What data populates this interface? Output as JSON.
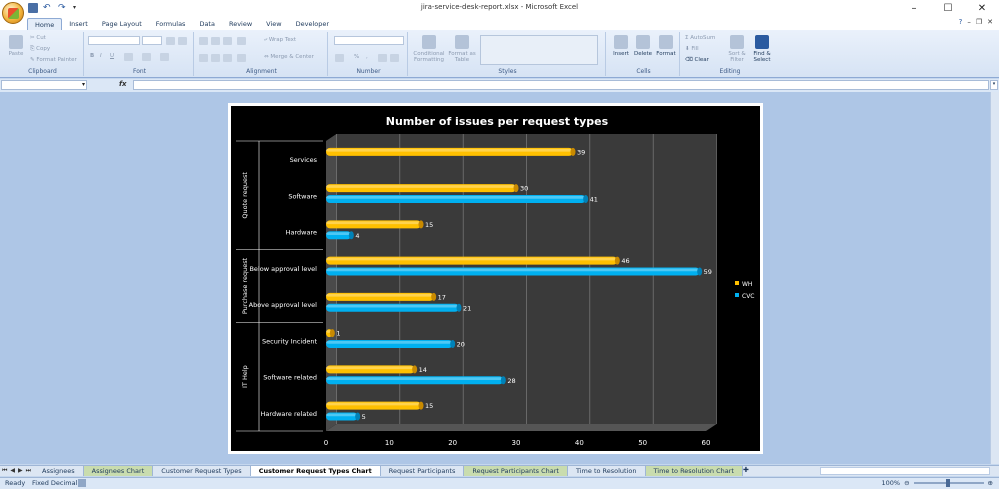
{
  "window": {
    "title": "jira-service-desk-report.xlsx - Microsoft Excel",
    "controls": [
      "–",
      "☐",
      "✕"
    ]
  },
  "ribbon_tabs": [
    "Home",
    "Insert",
    "Page Layout",
    "Formulas",
    "Data",
    "Review",
    "View",
    "Developer"
  ],
  "ribbon": {
    "clipboard": {
      "paste": "Paste",
      "cut": "Cut",
      "copy": "Copy",
      "format_painter": "Format Painter",
      "label": "Clipboard"
    },
    "font": {
      "label": "Font"
    },
    "alignment": {
      "wrap_text": "Wrap Text",
      "merge_center": "Merge & Center",
      "label": "Alignment"
    },
    "number": {
      "label": "Number"
    },
    "styles": {
      "conditional": "Conditional Formatting",
      "format_table": "Format as Table",
      "label": "Styles"
    },
    "cells": {
      "insert": "Insert",
      "delete": "Delete",
      "format": "Format",
      "label": "Cells"
    },
    "editing": {
      "autosum": "AutoSum",
      "fill": "Fill",
      "clear": "Clear",
      "sort_filter": "Sort & Filter",
      "find_select": "Find & Select",
      "label": "Editing"
    }
  },
  "formula_bar": {
    "fx": "fx",
    "name_box": "",
    "content": ""
  },
  "sheet_tabs": [
    {
      "label": "Assignees",
      "chart": false,
      "active": false
    },
    {
      "label": "Assignees Chart",
      "chart": true,
      "active": false
    },
    {
      "label": "Customer Request Types",
      "chart": false,
      "active": false
    },
    {
      "label": "Customer Request Types Chart",
      "chart": true,
      "active": true
    },
    {
      "label": "Request Participants",
      "chart": false,
      "active": false
    },
    {
      "label": "Request Participants Chart",
      "chart": true,
      "active": false
    },
    {
      "label": "Time to Resolution",
      "chart": false,
      "active": false
    },
    {
      "label": "Time to Resolution Chart",
      "chart": true,
      "active": false
    }
  ],
  "status_bar": {
    "ready": "Ready",
    "mode": "Fixed Decimal",
    "zoom": "100%"
  },
  "colors": {
    "wh": "#ffc000",
    "cvc": "#00b0f0",
    "chart_bg": "#000000",
    "plot_bg": "#3a3a3a"
  },
  "chart_data": {
    "type": "bar",
    "orientation": "horizontal",
    "title": "Number of issues per request types",
    "categories": [
      "Services",
      "Software",
      "Hardware",
      "Below approval level",
      "Above approval level",
      "Security Incident",
      "Software related",
      "Hardware related"
    ],
    "groups": [
      {
        "label": "Quote request",
        "categories": [
          "Services",
          "Software",
          "Hardware"
        ]
      },
      {
        "label": "Purchase request",
        "categories": [
          "Below approval level",
          "Above approval level"
        ]
      },
      {
        "label": "IT Help",
        "categories": [
          "Security Incident",
          "Software related",
          "Hardware related"
        ]
      }
    ],
    "series": [
      {
        "name": "WH",
        "values": [
          39,
          30,
          15,
          46,
          17,
          1,
          14,
          15
        ]
      },
      {
        "name": "CVC",
        "values": [
          null,
          41,
          4,
          59,
          21,
          20,
          28,
          5
        ]
      }
    ],
    "xlim": [
      0,
      60
    ],
    "x_ticks": [
      0,
      10,
      20,
      30,
      40,
      50,
      60
    ],
    "grid": true,
    "legend": "right"
  }
}
